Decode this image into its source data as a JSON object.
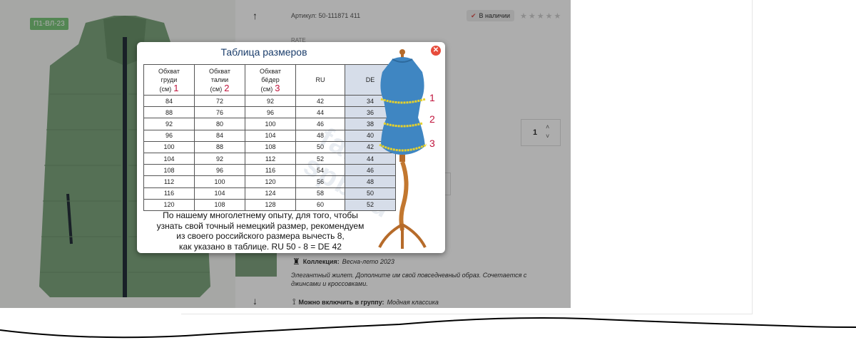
{
  "product": {
    "badge": "П1-ВЛ-23",
    "article": "Артикул: 50-111871 411",
    "stock": "В наличии",
    "stars": "★★★★★",
    "rate_label": "RATE",
    "quantity": "1",
    "collection_label": "Коллекция:",
    "collection_value": "Весна-лето 2023",
    "description": "Элегантный жилет. Дополните им свой повседневный образ. Сочетается с джинсами и кроссовками.",
    "group_label": "Можно включить в группу:",
    "group_value": "Модная классика"
  },
  "icons": [
    "arrow-up-icon",
    "arrow-down-icon",
    "check-icon",
    "star-icon",
    "close-icon",
    "chevron-up-icon",
    "chevron-down-icon"
  ],
  "colors": {
    "accent": "#c0143c",
    "badge": "#7bc67b",
    "de_column": "#d6dde9",
    "title": "#1a3d6b",
    "close": "#e74c3c"
  },
  "modal": {
    "title": "Таблица размеров",
    "headers": [
      {
        "l1": "Обхват",
        "l2": "груди",
        "l3": "(см)",
        "num": "1"
      },
      {
        "l1": "Обхват",
        "l2": "талии",
        "l3": "(см)",
        "num": "2"
      },
      {
        "l1": "Обхват",
        "l2": "бёдер",
        "l3": "(см)",
        "num": "3"
      },
      {
        "l1": "RU",
        "l2": "",
        "l3": "",
        "num": ""
      },
      {
        "l1": "DE",
        "l2": "",
        "l3": "",
        "num": ""
      }
    ],
    "rows": [
      [
        "84",
        "72",
        "92",
        "42",
        "34"
      ],
      [
        "88",
        "76",
        "96",
        "44",
        "36"
      ],
      [
        "92",
        "80",
        "100",
        "46",
        "38"
      ],
      [
        "96",
        "84",
        "104",
        "48",
        "40"
      ],
      [
        "100",
        "88",
        "108",
        "50",
        "42"
      ],
      [
        "104",
        "92",
        "112",
        "52",
        "44"
      ],
      [
        "108",
        "96",
        "116",
        "54",
        "46"
      ],
      [
        "112",
        "100",
        "120",
        "56",
        "48"
      ],
      [
        "116",
        "104",
        "124",
        "58",
        "50"
      ],
      [
        "120",
        "108",
        "128",
        "60",
        "52"
      ]
    ],
    "note_lines": [
      "По нашему многолетнему опыту, для того, чтобы",
      "узнать свой точный немецкий размер, рекомендуем",
      "из своего российского размера вычесть 8,",
      "как указано в таблице.  RU 50 - 8 = DE 42"
    ],
    "mannequin_numbers": [
      "1",
      "2",
      "3"
    ],
    "watermark": "fabe-spb.ru"
  }
}
